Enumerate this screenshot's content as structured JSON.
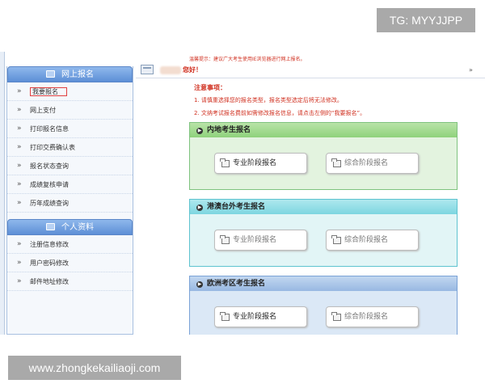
{
  "watermarks": {
    "top": "TG: MYYJJPP",
    "bottom": "www.zhongkekailiaoji.com"
  },
  "sidebar": {
    "section1_title": "网上报名",
    "section1_items": [
      {
        "label": "我要报名",
        "active": true
      },
      {
        "label": "网上支付"
      },
      {
        "label": "打印报名信息"
      },
      {
        "label": "打印交费确认表"
      },
      {
        "label": "报名状态查询"
      },
      {
        "label": "成绩复核申请"
      },
      {
        "label": "历年成绩查询"
      }
    ],
    "section2_title": "个人资料",
    "section2_items": [
      {
        "label": "注册信息修改"
      },
      {
        "label": "用户密码修改"
      },
      {
        "label": "邮件地址修改"
      }
    ]
  },
  "content": {
    "top_tip": "温馨提示：建议广大考生使用IE浏览器进行网上报名。",
    "greeting": "您好！",
    "more_glyph": "»",
    "notice_title": "注意事项：",
    "notice_1": "1. 请慎重选择您的报名类型，报名类型选定后将无法修改。",
    "notice_2": "2. 文纳考试报名费前如需修改报名信息，请点击左侧的“我要报名”。",
    "sections": [
      {
        "title": "内地考生报名",
        "btn1": "专业阶段报名",
        "btn2": "综合阶段报名"
      },
      {
        "title": "港澳台外考生报名",
        "btn1": "专业阶段报名",
        "btn2": "综合阶段报名"
      },
      {
        "title": "欧洲考区考生报名",
        "btn1": "专业阶段报名",
        "btn2": "综合阶段报名"
      }
    ]
  }
}
